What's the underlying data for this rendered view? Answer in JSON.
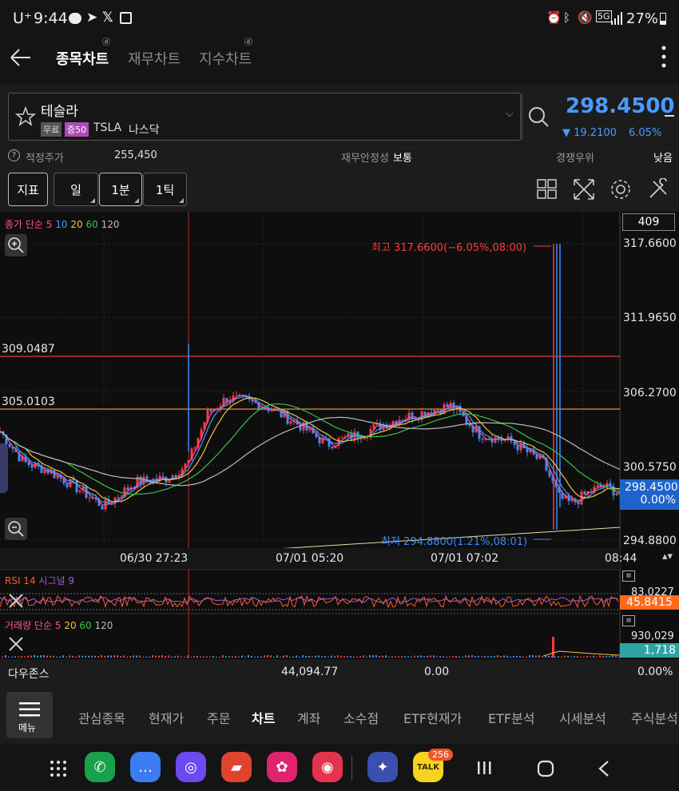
{
  "status": {
    "carrier": "U⁺",
    "time": "9:44",
    "battery": "27%"
  },
  "appbar": {
    "tabs": [
      "종목차트",
      "재무차트",
      "지수차트"
    ],
    "active_tab": 0
  },
  "stock": {
    "name": "테슬라",
    "badge_free": "무료",
    "badge_margin": "증50",
    "ticker": "TSLA",
    "market": "나스닥",
    "price": "298.4500",
    "change": "▼ 19.2100",
    "change_pct": "6.05%"
  },
  "info": {
    "fair_label": "적정주가",
    "fair_value": "255,450",
    "stability_label": "재무안정성",
    "stability_value": "보통",
    "competition_label": "경쟁우위",
    "competition_value": "낮음"
  },
  "toolbar": {
    "indicator": "지표",
    "period": "일",
    "interval": "1분",
    "tick": "1틱"
  },
  "chart_data": {
    "type": "candlestick",
    "legend": {
      "prefix": "종가 단순",
      "ma": [
        "5",
        "10",
        "20",
        "60",
        "120"
      ],
      "ma_colors": [
        "#ff4fa0",
        "#3aa0ff",
        "#f5c23c",
        "#37c24a",
        "#bbbbbb"
      ]
    },
    "count_box": "409",
    "yaxis_ticks": [
      "317.6600",
      "311.9650",
      "306.2700",
      "300.5750",
      "294.8800"
    ],
    "current_price": "298.4500",
    "current_change": "0.00%",
    "hlines": [
      {
        "label": "309.0487",
        "color": "#e23a3a"
      },
      {
        "label": "305.0103",
        "color": "#e8902c"
      }
    ],
    "high_note": "최고 317.6600(−6.05%,08:00)",
    "low_note": "최저 294.8800(1.21%,08:01)",
    "xaxis_ticks": [
      "06/30 27:23",
      "07/01 05:20",
      "07/01 07:02",
      "08:44"
    ],
    "ylim": [
      294.88,
      317.66
    ],
    "rsi": {
      "label": "RSI 14",
      "signal": "시그널 9",
      "value_top": "83.0227",
      "value": "45.8415"
    },
    "volume": {
      "prefix": "거래량 단순",
      "ma": [
        "5",
        "20",
        "60",
        "120"
      ],
      "ma_colors": [
        "#ff4fa0",
        "#f5c23c",
        "#37c24a",
        "#bbbbbb"
      ],
      "value_top": "930,029",
      "value": "1,718"
    }
  },
  "dow": {
    "label": "다우존스",
    "value": "44,094.77",
    "change": "0.00",
    "pct": "0.00%"
  },
  "bottomnav": {
    "menu": "메뉴",
    "items": [
      "관심종목",
      "현재가",
      "주문",
      "차트",
      "계좌",
      "소수점",
      "ETF현재가",
      "ETF분석",
      "시세분석",
      "주식분석"
    ],
    "active": 3
  },
  "sysnav": {
    "talk_badge": "256",
    "talk_text": "TALK"
  }
}
